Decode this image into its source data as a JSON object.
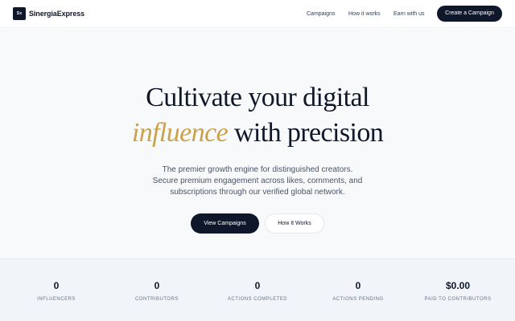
{
  "header": {
    "logo_text": "Sx",
    "brand": "SinergiaExpress",
    "nav": [
      "Campaigns",
      "How it works",
      "Earn with us"
    ],
    "cta": "Create a Campaign"
  },
  "hero": {
    "headline_line1": "Cultivate your digital",
    "headline_accent": "influence",
    "headline_line2_rest": " with precision",
    "subtitle": [
      "The premier growth engine for distinguished creators.",
      "Secure premium engagement across likes, comments, and",
      "subscriptions through our verified global network."
    ],
    "primary_button": "View Campaigns",
    "secondary_button": "How It Works"
  },
  "stats": [
    {
      "value": "0",
      "label": "INFLUENCERS"
    },
    {
      "value": "0",
      "label": "CONTRIBUTORS"
    },
    {
      "value": "0",
      "label": "ACTIONS COMPLETED"
    },
    {
      "value": "0",
      "label": "ACTIONS PENDING"
    },
    {
      "value": "$0.00",
      "label": "PAID TO CONTRIBUTORS"
    }
  ],
  "colors": {
    "primary": "#0f172a",
    "accent": "#c9a24a",
    "hero_bg": "#f8f9fa",
    "stats_bg": "#f1f4f8"
  }
}
